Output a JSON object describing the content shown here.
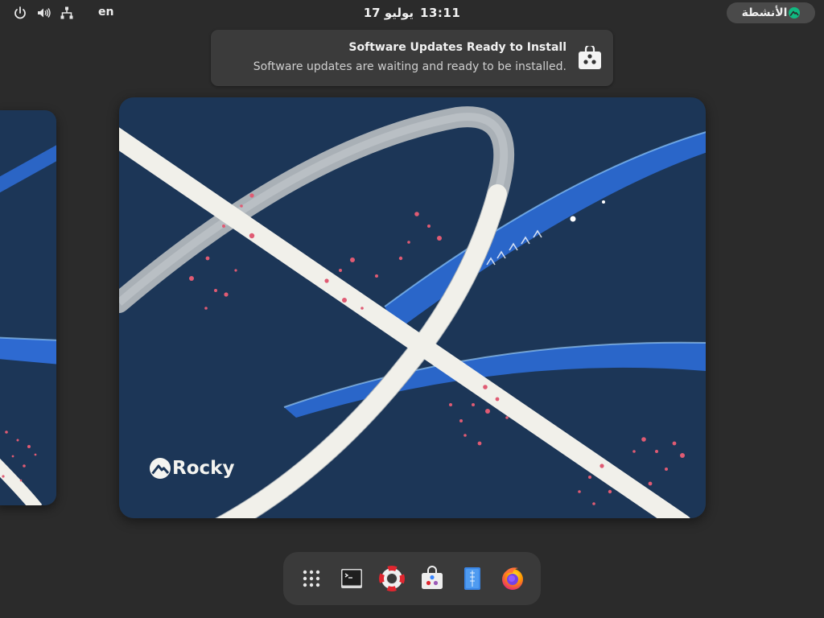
{
  "topbar": {
    "activities_label": "الأنشطة",
    "clock_date": "17 يوليو",
    "clock_time": "13:11",
    "language": "en",
    "status_icons": [
      "power-icon",
      "volume-icon",
      "network-icon"
    ]
  },
  "notification": {
    "title": "Software Updates Ready to Install",
    "body": "Software updates are waiting and ready to be installed.",
    "icon": "software-store-icon"
  },
  "wallpaper": {
    "brand_text": "Rocky",
    "bg_color": "#1c3657",
    "accent_color": "#2a66c9",
    "stroke_color": "#f1f0ea"
  },
  "dash": {
    "items": [
      {
        "name": "app-grid",
        "icon": "app-grid-icon"
      },
      {
        "name": "terminal",
        "icon": "terminal-icon"
      },
      {
        "name": "help",
        "icon": "help-lifebuoy-icon"
      },
      {
        "name": "software",
        "icon": "software-store-icon"
      },
      {
        "name": "text-editor",
        "icon": "text-editor-icon"
      },
      {
        "name": "firefox",
        "icon": "firefox-icon"
      }
    ]
  }
}
